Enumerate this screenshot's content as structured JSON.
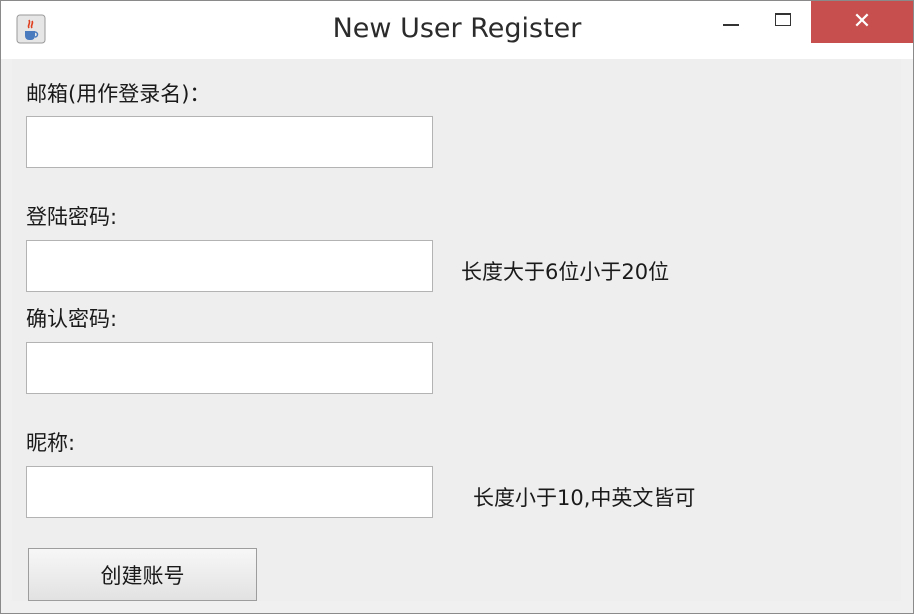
{
  "window": {
    "title": "New User Register",
    "close_glyph": "✕"
  },
  "form": {
    "email_label": "邮箱(用作登录名)：",
    "email_value": "",
    "password_label": "登陆密码:",
    "password_value": "",
    "password_hint": "长度大于6位小于20位",
    "confirm_label": "确认密码:",
    "confirm_value": "",
    "nickname_label": "昵称:",
    "nickname_value": "",
    "nickname_hint": "长度小于10,中英文皆可",
    "create_button": "创建账号"
  },
  "icons": {
    "app": "java-cup-icon",
    "minimize": "minimize-icon",
    "maximize": "maximize-icon",
    "close": "close-icon"
  },
  "colors": {
    "close_button": "#c7504f",
    "panel_background": "#eeeeee"
  }
}
